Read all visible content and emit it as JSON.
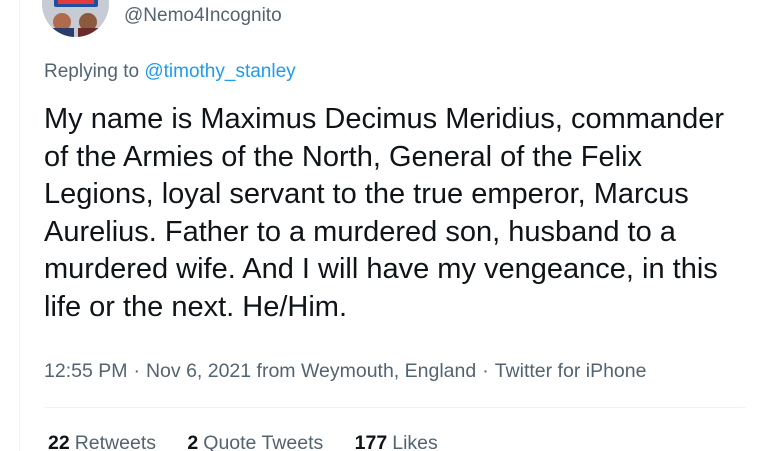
{
  "tweet": {
    "handle": "@Nemo4Incognito",
    "reply_prefix": "Replying to ",
    "reply_to": "@timothy_stanley",
    "text": "My name is Maximus Decimus Meridius, commander of the Armies of the North, General of the Felix Legions, loyal servant to the true emperor, Marcus Aurelius. Father to a murdered son, husband to a murdered wife. And I will have my vengeance, in this life or the next. He/Him.",
    "time": "12:55 PM",
    "date": "Nov 6, 2021",
    "location": "from Weymouth, England",
    "source": "Twitter for iPhone",
    "separator": "·"
  },
  "stats": {
    "retweets_count": "22",
    "retweets_label": "Retweets",
    "quotes_count": "2",
    "quotes_label": "Quote Tweets",
    "likes_count": "177",
    "likes_label": "Likes"
  },
  "colors": {
    "link": "#1d9bf0",
    "secondary_text": "#536471",
    "primary_text": "#0f1419",
    "divider": "#eff3f4"
  }
}
